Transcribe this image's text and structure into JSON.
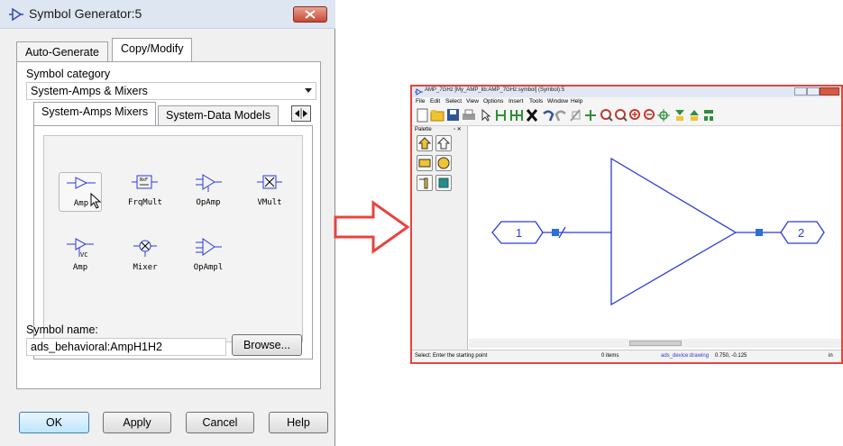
{
  "dialog": {
    "title": "Symbol Generator:5",
    "tabs": [
      "Auto-Generate",
      "Copy/Modify"
    ],
    "active_tab": "Copy/Modify",
    "category_label": "Symbol category",
    "category_value": "System-Amps & Mixers",
    "inner_tabs": [
      "System-Amps Mixers",
      "System-Data Models"
    ],
    "symbols": [
      {
        "label": "Amp"
      },
      {
        "label": "FrqMult"
      },
      {
        "label": "OpAmp"
      },
      {
        "label": "VMult"
      },
      {
        "label": "Amp"
      },
      {
        "label": "Mixer"
      },
      {
        "label": "OpAmpl"
      }
    ],
    "symbol_vc_text": "VC",
    "symbol_name_label": "Symbol name:",
    "symbol_name_value": "ads_behavioral:AmpH1H2",
    "browse_label": "Browse...",
    "buttons": {
      "ok": "OK",
      "apply": "Apply",
      "cancel": "Cancel",
      "help": "Help"
    }
  },
  "symbol_window": {
    "title": "AMP_7GHz [My_AMP_lib:AMP_7GHz:symbol] (Symbol):5",
    "menus": [
      "File",
      "Edit",
      "Select",
      "View",
      "Options",
      "Insert",
      "Tools",
      "Window",
      "Help"
    ],
    "palette_title": "Palette",
    "palette_controls": "▫ ✕",
    "pins": [
      "1",
      "2"
    ],
    "status_prompt": "Select: Enter the starting point",
    "status_items": "0 items",
    "status_context": "ads_device:drawing",
    "status_coords": "0.750, -0.125",
    "status_units": "in"
  },
  "colors": {
    "symbol_blue": "#2b3bd6",
    "pin_blue": "#2b6fd6",
    "arrow_red": "#e8433e",
    "accent_title": "#dde6f1"
  }
}
